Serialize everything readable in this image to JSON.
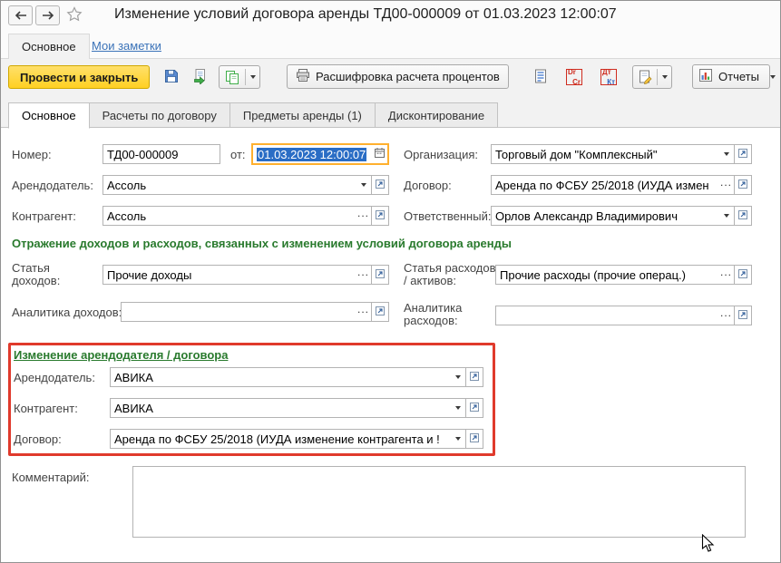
{
  "window": {
    "title": "Изменение условий договора аренды ТД00-000009 от 01.03.2023 12:00:07"
  },
  "nav": {
    "main_tab": "Основное",
    "notes_link": "Мои заметки"
  },
  "toolbar": {
    "post_close_label": "Провести и закрыть",
    "interest_button_label": "Расшифровка расчета процентов",
    "reports_label": "Отчеты",
    "drcr": {
      "top": "Dr",
      "bottom": "Cr"
    },
    "dtkt": {
      "top": "Дт",
      "bottom": "Кт"
    }
  },
  "tabs": {
    "main": "Основное",
    "settlements": "Расчеты по договору",
    "lease_items": "Предметы аренды (1)",
    "discounting": "Дисконтирование"
  },
  "form": {
    "number": {
      "label": "Номер:",
      "value": "ТД00-000009"
    },
    "date": {
      "label": "от:",
      "value": "01.03.2023 12:00:07"
    },
    "organization": {
      "label": "Организация:",
      "value": "Торговый дом \"Комплексный\""
    },
    "landlord": {
      "label": "Арендодатель:",
      "value": "Ассоль"
    },
    "contract": {
      "label": "Договор:",
      "value": "Аренда по ФСБУ 25/2018 (ИУДА  измен"
    },
    "counterparty": {
      "label": "Контрагент:",
      "value": "Ассоль"
    },
    "responsible": {
      "label": "Ответственный:",
      "value": "Орлов Александр Владимирович"
    },
    "comment": {
      "label": "Комментарий:",
      "value": ""
    }
  },
  "income_expense_section": {
    "title": "Отражение доходов и расходов, связанных с изменением условий договора аренды",
    "income_item": {
      "label_line1": "Статья",
      "label_line2": "доходов:",
      "value": "Прочие доходы"
    },
    "expense_item": {
      "label_line1": "Статья расходов",
      "label_line2": "/ активов:",
      "value": "Прочие расходы (прочие операц.)"
    },
    "income_analytics": {
      "label": "Аналитика доходов:",
      "value": ""
    },
    "expense_analytics": {
      "label_line1": "Аналитика",
      "label_line2": "расходов:",
      "value": ""
    }
  },
  "change_section": {
    "title": "Изменение арендодателя / договора",
    "landlord": {
      "label": "Арендодатель:",
      "value": "АВИКА"
    },
    "counterparty": {
      "label": "Контрагент:",
      "value": "АВИКА"
    },
    "contract": {
      "label": "Договор:",
      "value": "Аренда по ФСБУ 25/2018 (ИУДА  изменение контрагента и !"
    }
  },
  "colors": {
    "highlight_annotation": "#e03a2c",
    "focus_border": "#ffb02e",
    "text_selection": "#2a6dc5",
    "section_green": "#297a2d",
    "primary_button_yellow": "#ffd022",
    "link_blue": "#3a72b8"
  },
  "icons": {
    "back": "left-arrow",
    "forward": "right-arrow",
    "favorite": "star-outline",
    "save": "floppy-disk",
    "post": "document-green-arrow",
    "create_based_on": "green-copy",
    "print": "printer",
    "register_records": "document-lines",
    "dr_cr": "DrCr-stamp",
    "dt_kt": "ДтКт-stamp",
    "versions": "document-pencil",
    "reports": "bar-chart",
    "calendar": "calendar",
    "dropdown": "caret-down",
    "choose": "ellipsis",
    "open": "open-form-arrow"
  }
}
